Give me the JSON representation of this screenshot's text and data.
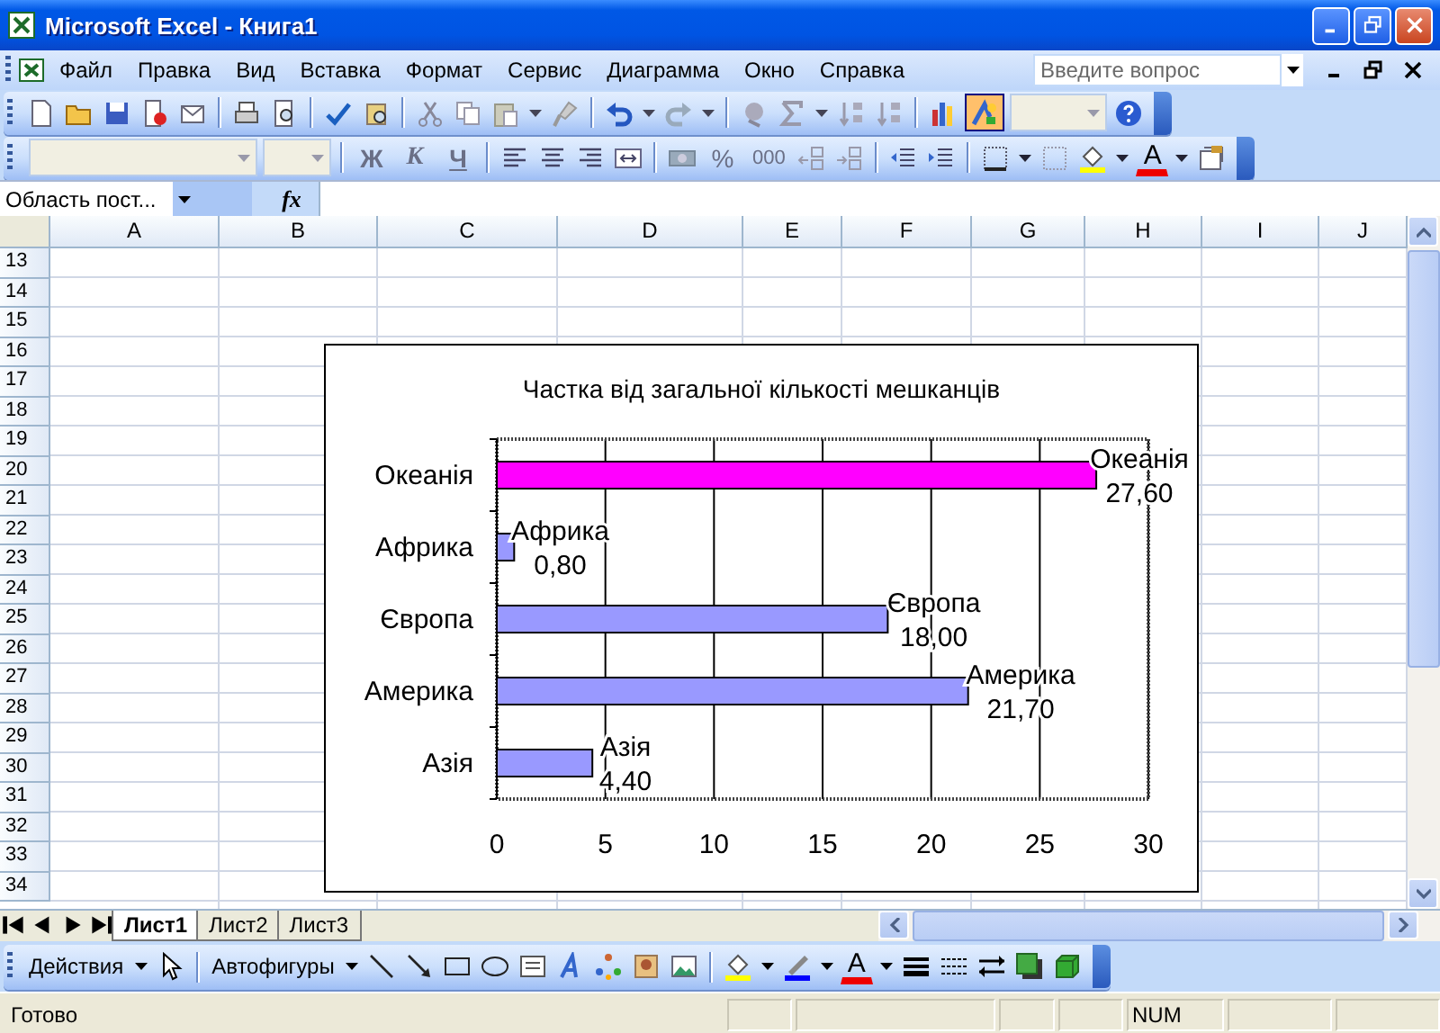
{
  "window": {
    "title": "Microsoft Excel - Книга1"
  },
  "menu": [
    "Файл",
    "Правка",
    "Вид",
    "Вставка",
    "Формат",
    "Сервис",
    "Диаграмма",
    "Окно",
    "Справка"
  ],
  "help_search": {
    "placeholder": "Введите вопрос"
  },
  "standard_toolbar": {
    "drawing_on": true
  },
  "format_toolbar": {
    "bold": "Ж",
    "italic": "К",
    "underline": "Ч",
    "percent": "%",
    "thousands": "000",
    "font_color": "A"
  },
  "formula_bar": {
    "name_box": "Область пост...",
    "fx": "fx"
  },
  "sheet": {
    "columns": [
      "A",
      "B",
      "C",
      "D",
      "E",
      "F",
      "G",
      "H",
      "I",
      "J"
    ],
    "rows": [
      "13",
      "14",
      "15",
      "16",
      "17",
      "18",
      "19",
      "20",
      "21",
      "22",
      "23",
      "24",
      "25",
      "26",
      "27",
      "28",
      "29",
      "30",
      "31",
      "32",
      "33",
      "34"
    ]
  },
  "chart": {
    "chart_data": {
      "type": "bar",
      "orientation": "horizontal",
      "title": "Частка від загальної кількості мешканців",
      "grid": true,
      "categories": [
        "Океанія",
        "Африка",
        "Європа",
        "Америка",
        "Азія"
      ],
      "series": [
        {
          "color": "#9999ff",
          "values": [
            null,
            0.8,
            18.0,
            21.7,
            4.4
          ],
          "value_labels": [
            null,
            "0,80",
            "18,00",
            "21,70",
            "4,40"
          ]
        },
        {
          "color": "#ff00ff",
          "values": [
            27.6,
            null,
            null,
            null,
            null
          ],
          "value_labels": [
            "27,60",
            null,
            null,
            null,
            null
          ]
        }
      ],
      "xlim": [
        0,
        30
      ],
      "xticks": [
        0,
        5,
        10,
        15,
        20,
        25,
        30
      ]
    }
  },
  "sheet_tabs": [
    {
      "label": "Лист1",
      "selected": true
    },
    {
      "label": "Лист2",
      "selected": false
    },
    {
      "label": "Лист3",
      "selected": false
    }
  ],
  "drawing_toolbar": {
    "actions": "Действия",
    "autoshapes": "Автофигуры",
    "font_color": "A"
  },
  "status_bar": {
    "text": "Готово",
    "num": "NUM"
  }
}
